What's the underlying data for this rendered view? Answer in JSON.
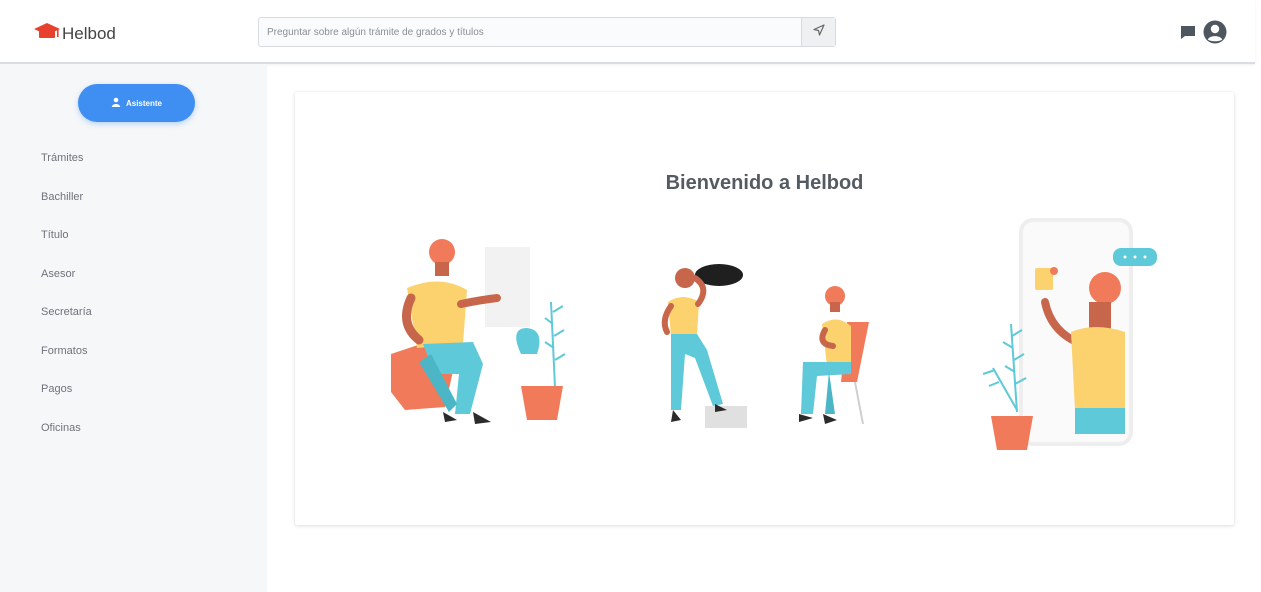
{
  "header": {
    "logo_text": "Helbod",
    "search": {
      "placeholder": "Preguntar sobre algún trámite de grados y títulos"
    },
    "icons": [
      "graduation-cap-icon",
      "send-icon",
      "chat-icon",
      "user-circle-icon"
    ]
  },
  "sidebar": {
    "assistant_button_label": "Asistente",
    "items": [
      {
        "label": "Trámites"
      },
      {
        "label": "Bachiller"
      },
      {
        "label": "Título"
      },
      {
        "label": "Asesor"
      },
      {
        "label": "Secretaría"
      },
      {
        "label": "Formatos"
      },
      {
        "label": "Pagos"
      },
      {
        "label": "Oficinas"
      }
    ]
  },
  "main": {
    "welcome_title": "Bienvenido a Helbod"
  },
  "colors": {
    "accent": "#3f8ef2",
    "logo_red": "#e8402e",
    "illustration_orange": "#f07a5a",
    "illustration_yellow": "#fbd26e",
    "illustration_teal": "#5ec9d8"
  }
}
